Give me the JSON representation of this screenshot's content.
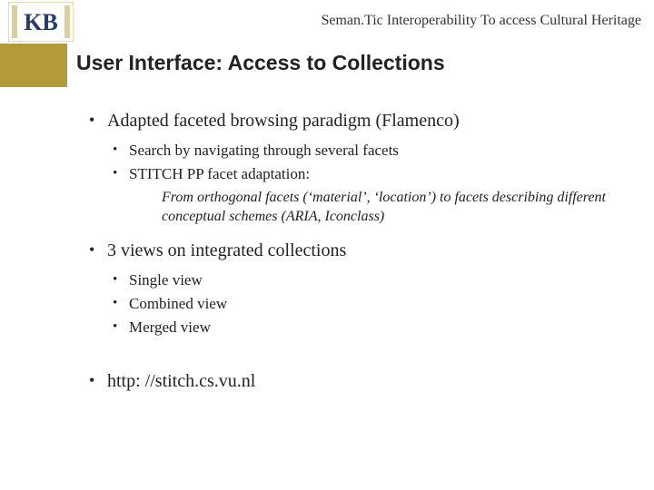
{
  "header": {
    "logo_letters": "KB",
    "title": "Seman.Tic Interoperability To access Cultural Heritage"
  },
  "slide": {
    "title": "User Interface: Access to Collections"
  },
  "bullets": {
    "b1": "Adapted faceted browsing paradigm (Flamenco)",
    "b1_sub1": "Search by navigating through several facets",
    "b1_sub2": "STITCH PP facet adaptation:",
    "b1_note": "From orthogonal facets (‘material’, ‘location’) to facets describing different conceptual schemes (ARIA, Iconclass)",
    "b2": "3 views on integrated collections",
    "b2_sub1": "Single view",
    "b2_sub2": "Combined view",
    "b2_sub3": "Merged view",
    "b3": "http: //stitch.cs.vu.nl"
  }
}
